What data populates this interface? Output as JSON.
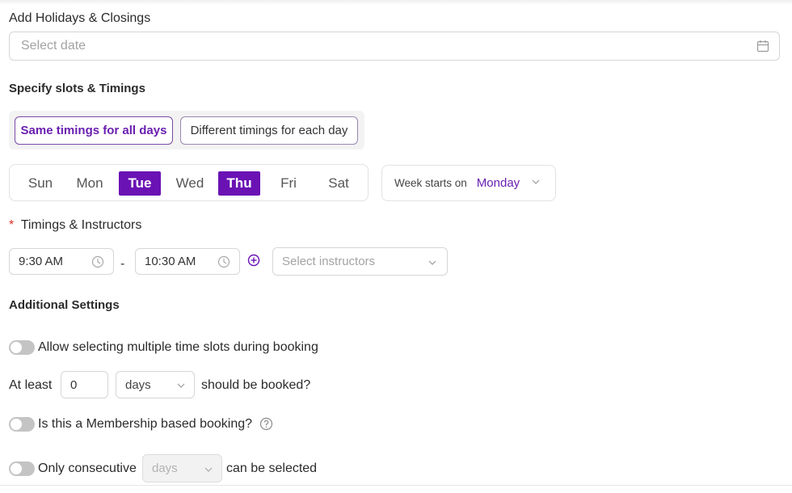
{
  "holidays": {
    "title": "Add Holidays & Closings",
    "date_placeholder": "Select date",
    "icon": "calendar-icon"
  },
  "slots": {
    "title": "Specify slots & Timings",
    "options": [
      {
        "label": "Same timings for all days",
        "active": true
      },
      {
        "label": "Different timings for each day",
        "active": false
      }
    ]
  },
  "days": [
    {
      "label": "Sun",
      "selected": false
    },
    {
      "label": "Mon",
      "selected": false
    },
    {
      "label": "Tue",
      "selected": true
    },
    {
      "label": "Wed",
      "selected": false
    },
    {
      "label": "Thu",
      "selected": true
    },
    {
      "label": "Fri",
      "selected": false
    },
    {
      "label": "Sat",
      "selected": false
    }
  ],
  "week": {
    "label": "Week starts on",
    "value": "Monday"
  },
  "timings": {
    "required_mark": "*",
    "title": "Timings & Instructors",
    "start": "9:30 AM",
    "separator": "-",
    "end": "10:30 AM",
    "instructors_placeholder": "Select instructors"
  },
  "additional": {
    "title": "Additional Settings",
    "multi_slot_label": "Allow selecting multiple time slots during booking",
    "at_least_prefix": "At least",
    "at_least_value": "0",
    "at_least_unit": "days",
    "at_least_suffix": "should be booked?",
    "membership_label": "Is this a Membership based booking?",
    "consecutive_prefix": "Only consecutive",
    "consecutive_unit": "days",
    "consecutive_suffix": "can be selected"
  },
  "colors": {
    "accent": "#6a12b4",
    "toggle_off": "#c4c4c4"
  }
}
